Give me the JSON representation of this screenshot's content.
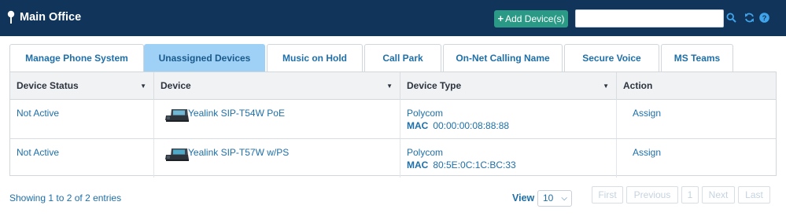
{
  "header": {
    "title": "Main Office",
    "add_button_label": "Add Device(s)",
    "search_value": "",
    "search_placeholder": ""
  },
  "tabs": [
    {
      "label": "Manage Phone System",
      "active": false
    },
    {
      "label": "Unassigned Devices",
      "active": true
    },
    {
      "label": "Music on Hold",
      "active": false
    },
    {
      "label": "Call Park",
      "active": false
    },
    {
      "label": "On-Net Calling Name",
      "active": false
    },
    {
      "label": "Secure Voice",
      "active": false
    },
    {
      "label": "MS Teams",
      "active": false
    }
  ],
  "table": {
    "columns": [
      "Device Status",
      "Device",
      "Device Type",
      "Action"
    ],
    "rows": [
      {
        "status": "Not Active",
        "device": "Yealink SIP-T54W PoE",
        "device_type": "Polycom",
        "mac_label": "MAC",
        "mac": "00:00:00:08:88:88",
        "action": "Assign"
      },
      {
        "status": "Not Active",
        "device": "Yealink SIP-T57W w/PS",
        "device_type": "Polycom",
        "mac_label": "MAC",
        "mac": "80:5E:0C:1C:BC:33",
        "action": "Assign"
      }
    ]
  },
  "footer": {
    "showing_text": "Showing 1 to 2 of 2 entries",
    "view_label": "View",
    "view_value": "10",
    "pagination": [
      "First",
      "Previous",
      "1",
      "Next",
      "Last"
    ]
  },
  "icons": {
    "location": "map-pin-icon",
    "add": "plus-icon",
    "search": "search-icon",
    "refresh": "refresh-icon",
    "help": "help-icon",
    "sort": "caret-down-icon",
    "device": "desk-phone-icon"
  },
  "colors": {
    "header_bg": "#11345a",
    "accent": "#2a9a86",
    "active_tab": "#9fd1f7",
    "link": "#1f6fa8"
  }
}
